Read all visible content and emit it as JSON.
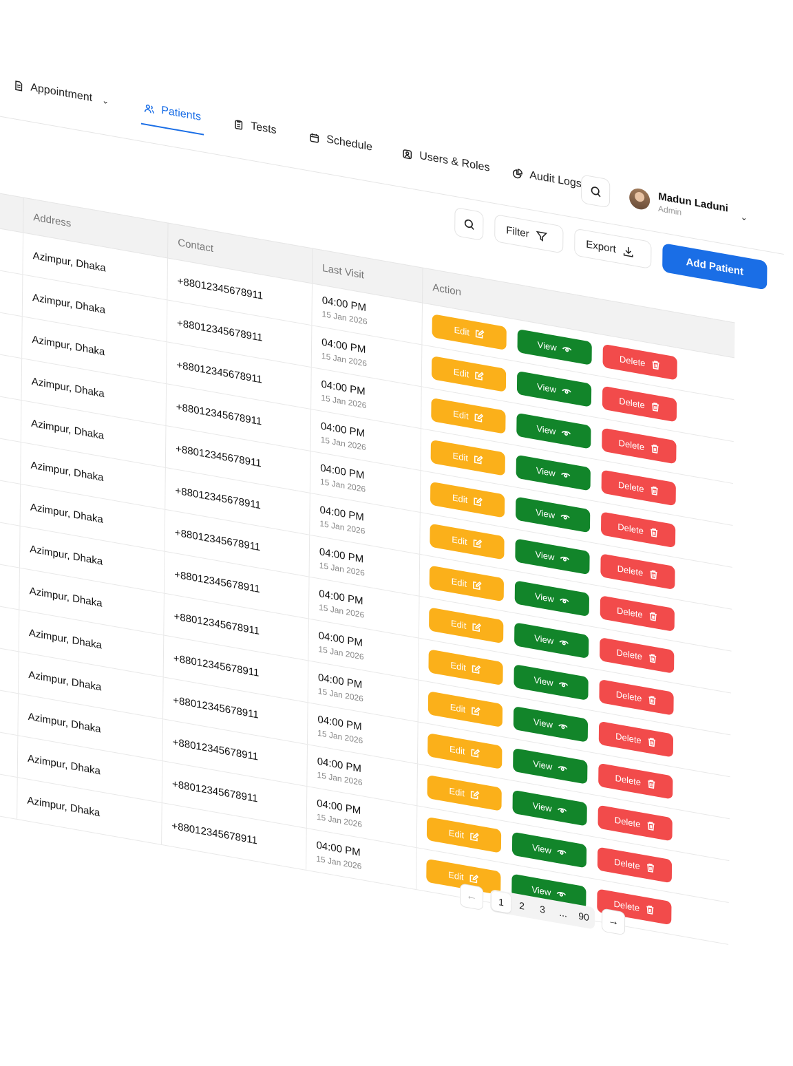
{
  "nav": {
    "items": [
      {
        "label": "Appointment",
        "icon": "document-icon",
        "dropdown": true
      },
      {
        "label": "Patients",
        "icon": "users-icon",
        "active": true
      },
      {
        "label": "Tests",
        "icon": "clipboard-icon"
      },
      {
        "label": "Schedule",
        "icon": "calendar-icon"
      },
      {
        "label": "Users & Roles",
        "icon": "user-square-icon"
      },
      {
        "label": "Audit Logs",
        "icon": "pie-chart-icon"
      }
    ]
  },
  "user": {
    "name": "Madun Laduni",
    "role": "Admin"
  },
  "toolbar": {
    "filter_label": "Filter",
    "export_label": "Export",
    "add_label": "Add Patient"
  },
  "table": {
    "columns": [
      "Address",
      "Contact",
      "Last Visit",
      "Action"
    ],
    "rows": [
      {
        "address": "Azimpur, Dhaka",
        "contact": "+88012345678911",
        "time": "04:00 PM",
        "date": "15 Jan 2026"
      },
      {
        "address": "Azimpur, Dhaka",
        "contact": "+88012345678911",
        "time": "04:00 PM",
        "date": "15 Jan 2026"
      },
      {
        "address": "Azimpur, Dhaka",
        "contact": "+88012345678911",
        "time": "04:00 PM",
        "date": "15 Jan 2026"
      },
      {
        "address": "Azimpur, Dhaka",
        "contact": "+88012345678911",
        "time": "04:00 PM",
        "date": "15 Jan 2026"
      },
      {
        "address": "Azimpur, Dhaka",
        "contact": "+88012345678911",
        "time": "04:00 PM",
        "date": "15 Jan 2026"
      },
      {
        "address": "Azimpur, Dhaka",
        "contact": "+88012345678911",
        "time": "04:00 PM",
        "date": "15 Jan 2026"
      },
      {
        "address": "Azimpur, Dhaka",
        "contact": "+88012345678911",
        "time": "04:00 PM",
        "date": "15 Jan 2026"
      },
      {
        "address": "Azimpur, Dhaka",
        "contact": "+88012345678911",
        "time": "04:00 PM",
        "date": "15 Jan 2026"
      },
      {
        "address": "Azimpur, Dhaka",
        "contact": "+88012345678911",
        "time": "04:00 PM",
        "date": "15 Jan 2026"
      },
      {
        "address": "Azimpur, Dhaka",
        "contact": "+88012345678911",
        "time": "04:00 PM",
        "date": "15 Jan 2026"
      },
      {
        "address": "Azimpur, Dhaka",
        "contact": "+88012345678911",
        "time": "04:00 PM",
        "date": "15 Jan 2026"
      },
      {
        "address": "Azimpur, Dhaka",
        "contact": "+88012345678911",
        "time": "04:00 PM",
        "date": "15 Jan 2026"
      },
      {
        "address": "Azimpur, Dhaka",
        "contact": "+88012345678911",
        "time": "04:00 PM",
        "date": "15 Jan 2026"
      },
      {
        "address": "Azimpur, Dhaka",
        "contact": "+88012345678911",
        "time": "04:00 PM",
        "date": "15 Jan 2026"
      }
    ],
    "actions": {
      "edit": "Edit",
      "view": "View",
      "delete": "Delete"
    }
  },
  "pagination": {
    "pages": [
      "1",
      "2",
      "3",
      "...",
      "90"
    ],
    "current": "1",
    "prev": "←",
    "next": "→"
  },
  "colors": {
    "accent": "#1a6ee6",
    "edit": "#fbb01a",
    "view": "#12852a",
    "delete": "#f24b4b"
  }
}
